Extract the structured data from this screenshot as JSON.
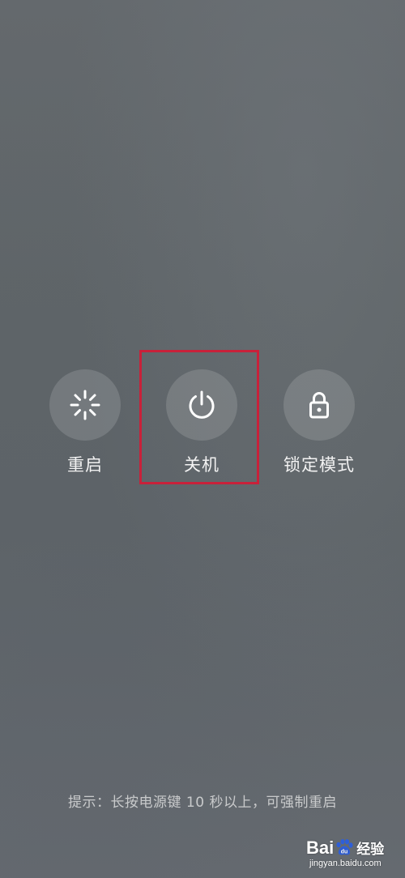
{
  "power_menu": {
    "options": [
      {
        "label": "重启",
        "icon": "restart-spinner-icon"
      },
      {
        "label": "关机",
        "icon": "power-icon"
      },
      {
        "label": "锁定模式",
        "icon": "lock-icon"
      }
    ],
    "highlighted_option": "关机",
    "highlight_color": "#c8213a"
  },
  "hint": {
    "text": "提示：长按电源键 10 秒以上，可强制重启"
  },
  "watermark": {
    "brand_left": "Bai",
    "brand_right": "经验",
    "domain": "jingyan.baidu.com"
  }
}
